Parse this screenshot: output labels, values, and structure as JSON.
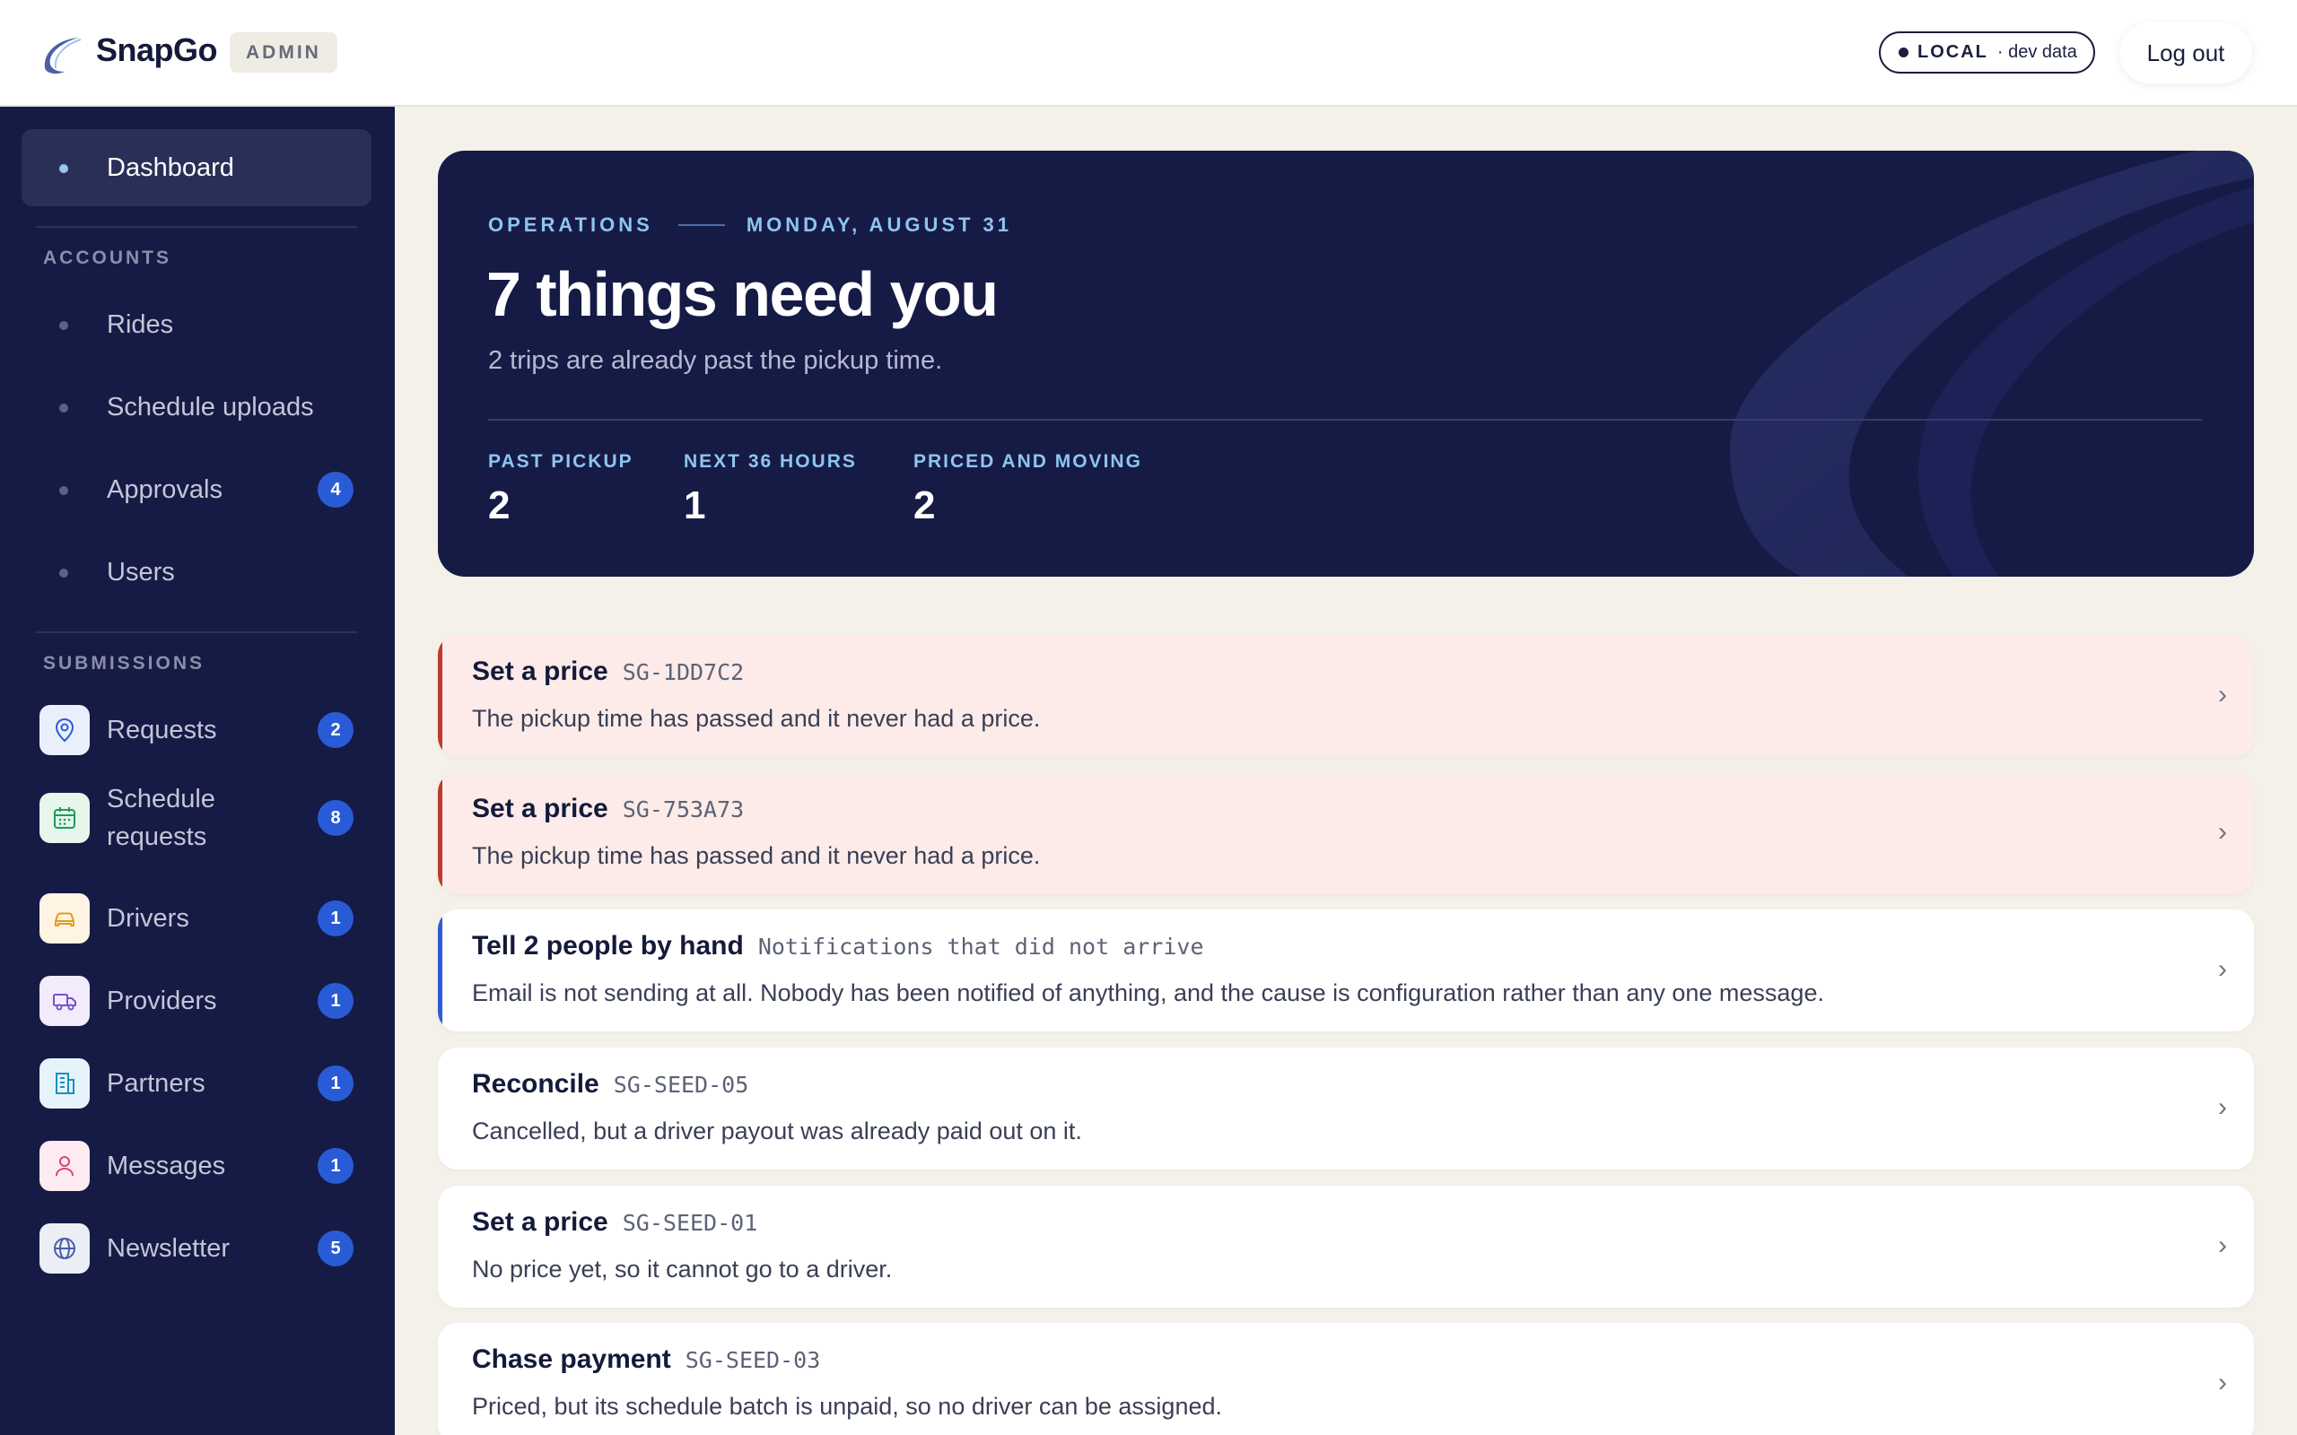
{
  "header": {
    "brand": "SnapGo",
    "badge": "ADMIN",
    "env": {
      "label": "LOCAL",
      "sub": "· dev data"
    },
    "logout": "Log out"
  },
  "sidebar": {
    "dashboard": "Dashboard",
    "accounts_title": "ACCOUNTS",
    "accounts": [
      {
        "label": "Rides"
      },
      {
        "label": "Schedule uploads"
      },
      {
        "label": "Approvals",
        "badge": "4"
      },
      {
        "label": "Users"
      }
    ],
    "submissions_title": "SUBMISSIONS",
    "submissions": [
      {
        "label": "Requests",
        "badge": "2",
        "icon": "location-pin-icon"
      },
      {
        "label": "Schedule requests",
        "badge": "8",
        "icon": "calendar-icon"
      },
      {
        "label": "Drivers",
        "badge": "1",
        "icon": "car-icon"
      },
      {
        "label": "Providers",
        "badge": "1",
        "icon": "truck-icon"
      },
      {
        "label": "Partners",
        "badge": "1",
        "icon": "building-icon"
      },
      {
        "label": "Messages",
        "badge": "1",
        "icon": "person-icon"
      },
      {
        "label": "Newsletter",
        "badge": "5",
        "icon": "globe-icon"
      }
    ]
  },
  "hero": {
    "kicker": "OPERATIONS",
    "date": "MONDAY, AUGUST 31",
    "title": "7 things need you",
    "subtitle": "2 trips are already past the pickup time.",
    "stats": [
      {
        "label": "PAST PICKUP",
        "value": "2"
      },
      {
        "label": "NEXT 36 HOURS",
        "value": "1"
      },
      {
        "label": "PRICED AND MOVING",
        "value": "2"
      }
    ]
  },
  "tasks": [
    {
      "title": "Set a price",
      "code": "SG-1DD7C2",
      "desc": "The pickup time has passed and it never had a price.",
      "kind": "urgent"
    },
    {
      "title": "Set a price",
      "code": "SG-753A73",
      "desc": "The pickup time has passed and it never had a price.",
      "kind": "urgent"
    },
    {
      "title": "Tell 2 people by hand",
      "code": "Notifications that did not arrive",
      "desc": "Email is not sending at all. Nobody has been notified of anything, and the cause is configuration rather than any one message.",
      "kind": "notice"
    },
    {
      "title": "Reconcile",
      "code": "SG-SEED-05",
      "desc": "Cancelled, but a driver payout was already paid out on it.",
      "kind": "normal"
    },
    {
      "title": "Set a price",
      "code": "SG-SEED-01",
      "desc": "No price yet, so it cannot go to a driver.",
      "kind": "normal"
    },
    {
      "title": "Chase payment",
      "code": "SG-SEED-03",
      "desc": "Priced, but its schedule batch is unpaid, so no driver can be assigned.",
      "kind": "normal"
    }
  ],
  "colors": {
    "navy": "#161b45",
    "urgent_accent": "#c0392b",
    "notice_accent": "#2a5bd7",
    "badge_blue": "#2a5bd7",
    "urgent_bg": "#fcebe8"
  }
}
